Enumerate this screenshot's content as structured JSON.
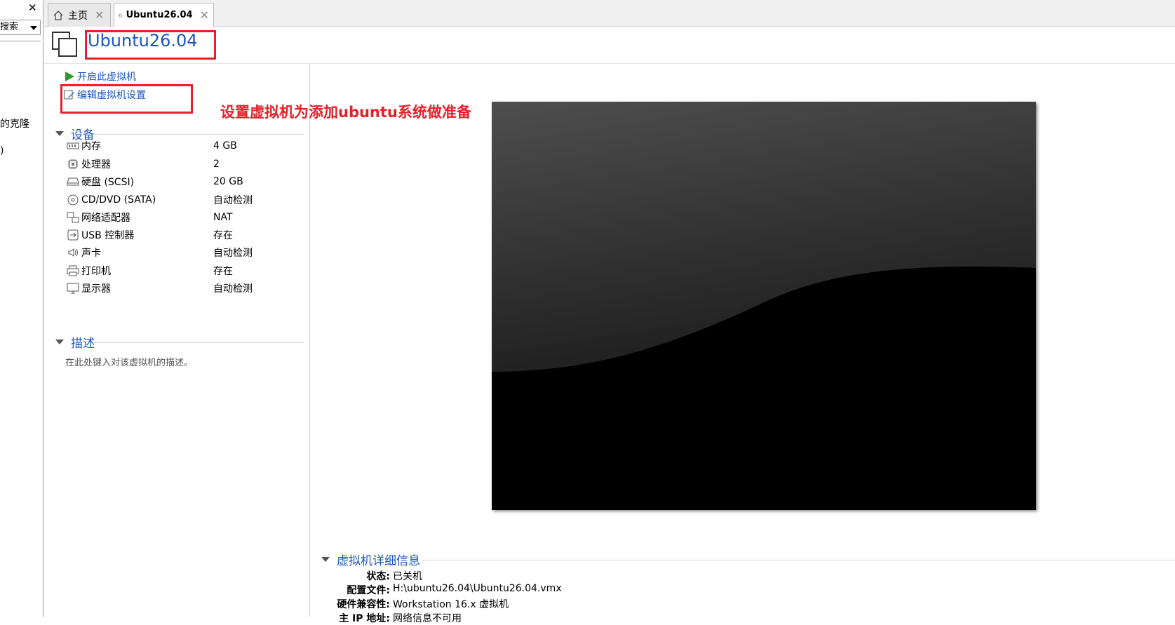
{
  "library": {
    "close_glyph": "✕",
    "search_text": "搜索",
    "items": [
      "的克隆",
      ")"
    ]
  },
  "tabs": [
    {
      "label": "主页",
      "close": "✕",
      "icon": "home-icon"
    },
    {
      "label": "Ubuntu26.04",
      "close": "✕",
      "icon": "vm-icon"
    }
  ],
  "vm": {
    "title": "Ubuntu26.04",
    "actions": {
      "power_on": "开启此虚拟机",
      "edit_settings": "编辑虚拟机设置"
    },
    "devices_header": "设备",
    "devices": [
      {
        "name": "内存",
        "value": "4 GB",
        "icon": "memory-icon"
      },
      {
        "name": "处理器",
        "value": "2",
        "icon": "cpu-icon"
      },
      {
        "name": "硬盘 (SCSI)",
        "value": "20 GB",
        "icon": "harddisk-icon"
      },
      {
        "name": "CD/DVD (SATA)",
        "value": "自动检测",
        "icon": "cdrom-icon"
      },
      {
        "name": "网络适配器",
        "value": "NAT",
        "icon": "network-icon"
      },
      {
        "name": "USB 控制器",
        "value": "存在",
        "icon": "usb-icon"
      },
      {
        "name": "声卡",
        "value": "自动检测",
        "icon": "speaker-icon"
      },
      {
        "name": "打印机",
        "value": "存在",
        "icon": "printer-icon"
      },
      {
        "name": "显示器",
        "value": "自动检测",
        "icon": "monitor-icon"
      }
    ],
    "description_header": "描述",
    "description_placeholder": "在此处键入对该虚拟机的描述。",
    "details_header": "虚拟机详细信息",
    "details": [
      {
        "key": "状态:",
        "value": "已关机"
      },
      {
        "key": "配置文件:",
        "value": "H:\\ubuntu26.04\\Ubuntu26.04.vmx"
      },
      {
        "key": "硬件兼容性:",
        "value": "Workstation 16.x 虚拟机"
      },
      {
        "key": "主 IP 地址:",
        "value": "网络信息不可用"
      }
    ]
  },
  "annotation": {
    "text": "设置虚拟机为添加ubuntu系统做准备",
    "color": "#e8202a"
  },
  "colors": {
    "link_blue": "#1a55c4",
    "annotation_red": "#e8202a",
    "play_green": "#2e9a2e"
  }
}
